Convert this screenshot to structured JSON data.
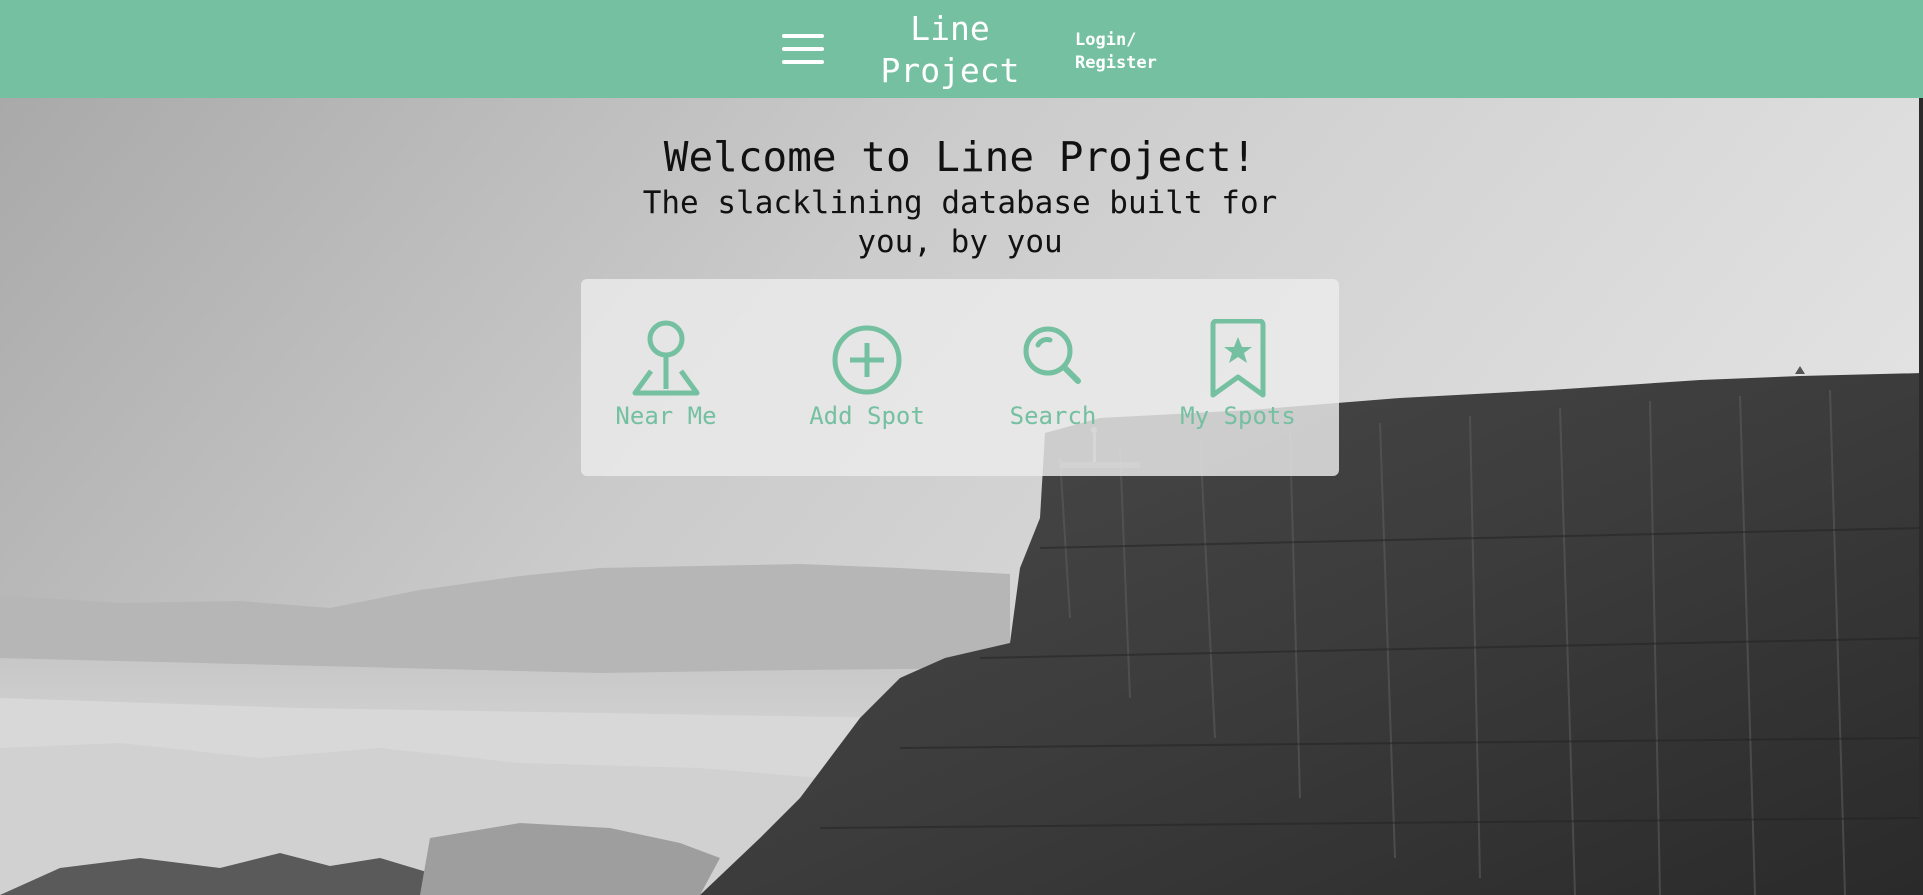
{
  "header": {
    "brand_line1": "Line",
    "brand_line2": "Project",
    "login_line1": "Login/",
    "login_line2": "Register",
    "menu_icon": "hamburger-menu-icon",
    "background_color": "#74c0a1"
  },
  "hero": {
    "title": "Welcome to Line Project!",
    "subtitle": "The slacklining database built for you, by you"
  },
  "actions": [
    {
      "label": "Near Me",
      "icon": "map-pin-icon"
    },
    {
      "label": "Add Spot",
      "icon": "plus-circle-icon"
    },
    {
      "label": "Search",
      "icon": "magnifier-icon"
    },
    {
      "label": "My Spots",
      "icon": "bookmark-star-icon"
    }
  ],
  "colors": {
    "accent": "#74c0a1",
    "text": "#111111",
    "header_text": "#ffffff"
  }
}
